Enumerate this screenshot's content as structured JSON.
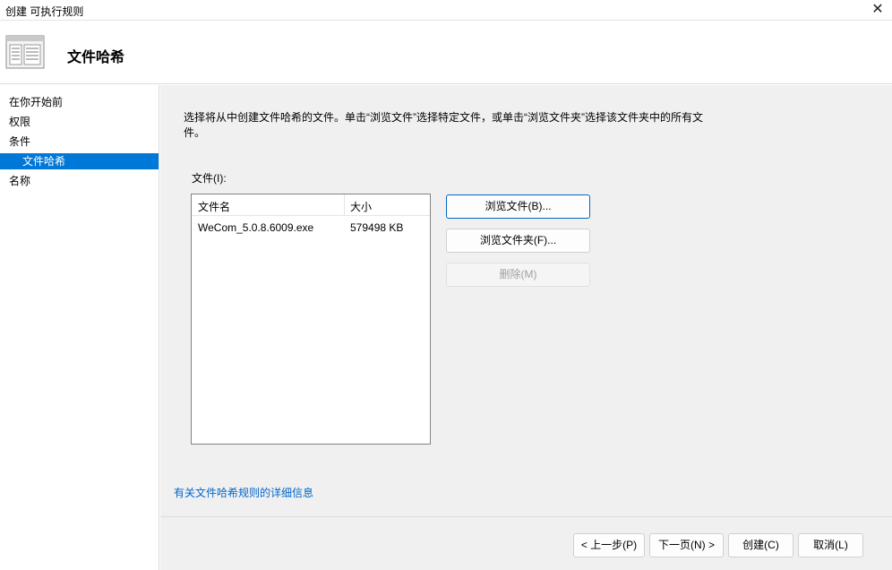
{
  "window": {
    "title": "创建 可执行规则",
    "close_glyph": "✕"
  },
  "header": {
    "title": "文件哈希",
    "icon": "window-list-icon"
  },
  "sidebar": {
    "items": [
      {
        "label": "在你开始前"
      },
      {
        "label": "权限"
      },
      {
        "label": "条件"
      },
      {
        "label": "文件哈希",
        "selected": true
      },
      {
        "label": "名称"
      }
    ]
  },
  "main": {
    "description": "选择将从中创建文件哈希的文件。单击“浏览文件”选择特定文件，或单击“浏览文件夹”选择该文件夹中的所有文件。",
    "files_label": "文件(I):",
    "table": {
      "columns": [
        "文件名",
        "大小"
      ],
      "rows": [
        {
          "name": "WeCom_5.0.8.6009.exe",
          "size": "579498 KB"
        }
      ]
    },
    "buttons": {
      "browse_files": "浏览文件(B)...",
      "browse_folder": "浏览文件夹(F)...",
      "delete": "删除(M)"
    },
    "link": "有关文件哈希规则的详细信息"
  },
  "footer": {
    "back": "< 上一步(P)",
    "next": "下一页(N) >",
    "create": "创建(C)",
    "cancel": "取消(L)"
  },
  "colors": {
    "accent": "#0078d7",
    "link": "#0066cc",
    "panel": "#f0f0f0"
  }
}
